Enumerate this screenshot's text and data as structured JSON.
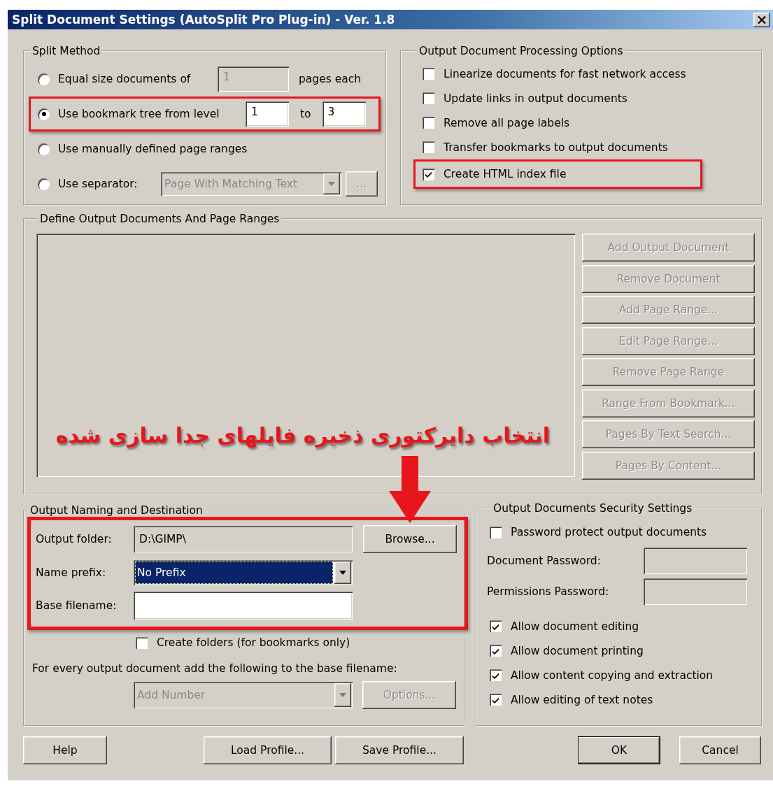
{
  "window": {
    "title": "Split Document Settings (AutoSplit Pro Plug-in) - Ver. 1.8"
  },
  "split_method": {
    "title": "Split Method",
    "options": [
      {
        "kind": "count",
        "label": "Equal size documents of",
        "value": "1",
        "suffix": "pages each",
        "selected": false,
        "highlighted": false
      },
      {
        "kind": "range",
        "label": "Use bookmark tree from level",
        "from": "1",
        "joiner": "to",
        "to": "3",
        "selected": true,
        "highlighted": true
      },
      {
        "kind": "plain",
        "label": "Use manually defined page ranges",
        "selected": false,
        "highlighted": false
      },
      {
        "kind": "separator",
        "label": "Use separator:",
        "value": "Page With Matching Text",
        "button": "...",
        "selected": false,
        "highlighted": false
      }
    ]
  },
  "processing": {
    "title": "Output Document Processing Options",
    "options": [
      {
        "label": "Linearize documents for fast network access",
        "checked": false,
        "highlighted": false
      },
      {
        "label": "Update links in output documents",
        "checked": false,
        "highlighted": false
      },
      {
        "label": "Remove all page labels",
        "checked": false,
        "highlighted": false
      },
      {
        "label": "Transfer bookmarks to output documents",
        "checked": false,
        "highlighted": false
      },
      {
        "label": "Create HTML index file",
        "checked": true,
        "highlighted": true
      }
    ]
  },
  "ranges": {
    "title": "Define Output Documents And Page Ranges",
    "buttons": [
      {
        "label": "Add Output Document",
        "disabled": true
      },
      {
        "label": "Remove Document",
        "disabled": true
      },
      {
        "label": "Add Page Range...",
        "disabled": true
      },
      {
        "label": "Edit Page Range...",
        "disabled": true
      },
      {
        "label": "Remove Page Range",
        "disabled": true
      },
      {
        "label": "Range From Bookmark...",
        "disabled": true
      },
      {
        "label": "Pages By Text Search...",
        "disabled": true
      },
      {
        "label": "Pages By Content...",
        "disabled": true
      }
    ]
  },
  "annotation": {
    "text": "انتخاب دایرکتوری ذخیره فایلهای جدا سازی شده"
  },
  "naming": {
    "title": "Output Naming and Destination",
    "highlighted": true,
    "output_folder": {
      "label": "Output folder:",
      "value": "D:\\GIMP\\"
    },
    "browse": {
      "label": "Browse..."
    },
    "name_prefix": {
      "label": "Name prefix:",
      "value": "No Prefix",
      "focused": true
    },
    "base_filename": {
      "label": "Base filename:"
    },
    "create_folders": {
      "label": "Create folders (for bookmarks only)",
      "checked": false
    },
    "suffix_note": "For every output document add the following to the base filename:",
    "suffix_select": {
      "value": "Add Number",
      "disabled": true
    },
    "options_button": {
      "label": "Options...",
      "disabled": true
    }
  },
  "security": {
    "title": "Output Documents Security Settings",
    "protect": {
      "label": "Password protect output documents",
      "checked": false
    },
    "fields": [
      {
        "label": "Document Password:",
        "disabled": true
      },
      {
        "label": "Permissions Password:",
        "disabled": true
      }
    ],
    "permissions": [
      {
        "label": "Allow document editing",
        "checked": true
      },
      {
        "label": "Allow document printing",
        "checked": true
      },
      {
        "label": "Allow content copying and extraction",
        "checked": true
      },
      {
        "label": "Allow editing of text notes",
        "checked": true
      }
    ]
  },
  "footer": {
    "left": [
      {
        "label": "Help",
        "default": false
      }
    ],
    "middle": [
      {
        "label": "Load Profile...",
        "default": false
      },
      {
        "label": "Save Profile...",
        "default": false
      }
    ],
    "right": [
      {
        "label": "OK",
        "default": true
      },
      {
        "label": "Cancel",
        "default": false
      }
    ]
  }
}
